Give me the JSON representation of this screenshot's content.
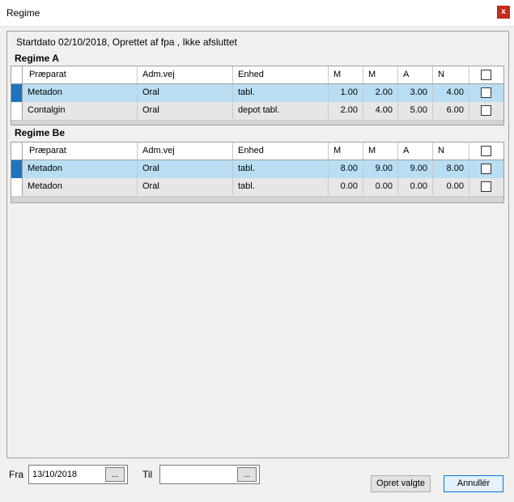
{
  "window": {
    "title": "Regime",
    "close_label": "x"
  },
  "header": {
    "info": "Startdato 02/10/2018, Oprettet af fpa , Ikke afsluttet"
  },
  "columns": {
    "praeparat": "Præparat",
    "admvej": "Adm.vej",
    "enhed": "Enhed",
    "m1": "M",
    "m2": "M",
    "a": "A",
    "n": "N"
  },
  "regimes": [
    {
      "title": "Regime A",
      "rows": [
        {
          "praeparat": "Metadon",
          "admvej": "Oral",
          "enhed": "tabl.",
          "m1": "1.00",
          "m2": "2.00",
          "a": "3.00",
          "n": "4.00",
          "selected": true
        },
        {
          "praeparat": "Contalgin",
          "admvej": "Oral",
          "enhed": "depot tabl.",
          "m1": "2.00",
          "m2": "4.00",
          "a": "5.00",
          "n": "6.00",
          "selected": false
        }
      ]
    },
    {
      "title": "Regime Be",
      "rows": [
        {
          "praeparat": "Metadon",
          "admvej": "Oral",
          "enhed": "tabl.",
          "m1": "8.00",
          "m2": "9.00",
          "a": "9.00",
          "n": "8.00",
          "selected": true
        },
        {
          "praeparat": "Metadon",
          "admvej": "Oral",
          "enhed": "tabl.",
          "m1": "0.00",
          "m2": "0.00",
          "a": "0.00",
          "n": "0.00",
          "selected": false
        }
      ]
    }
  ],
  "footer": {
    "fra_label": "Fra",
    "fra_value": "13/10/2018",
    "til_label": "Til",
    "til_value": "",
    "picker_label": "...",
    "opret_label": "Opret valgte",
    "annuller_label": "Annullér"
  }
}
